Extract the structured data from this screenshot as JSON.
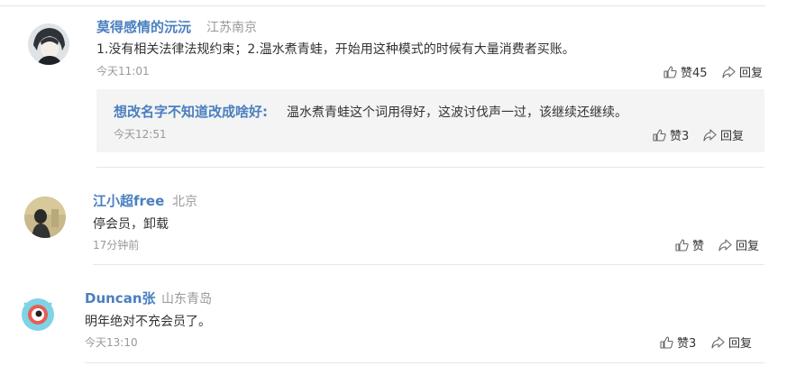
{
  "comments": [
    {
      "user": "莫得感情的沅沅",
      "location": "江苏南京",
      "text": "1.没有相关法律法规约束；2.温水煮青蛙，开始用这种模式的时候有大量消费者买账。",
      "time": "今天11:01",
      "like_label": "赞45",
      "reply_label": "回复",
      "nested_reply": {
        "user": "想改名字不知道改成啥好:",
        "text": "温水煮青蛙这个词用得好，这波讨伐声一过，该继续还继续。",
        "time": "今天12:51",
        "like_label": "赞3",
        "reply_label": "回复"
      }
    },
    {
      "user": "江小超free",
      "location": "北京",
      "text": "停会员，卸载",
      "time": "17分钟前",
      "like_label": "赞",
      "reply_label": "回复"
    },
    {
      "user": "Duncan张",
      "location": "山东青岛",
      "text": "明年绝对不充会员了。",
      "time": "今天13:10",
      "like_label": "赞3",
      "reply_label": "回复"
    }
  ],
  "icons": {
    "like": "thumbs-up-icon",
    "reply": "share-arrow-icon"
  },
  "colors": {
    "username": "#4a7fbf",
    "meta": "#999999",
    "reply_bg": "#f4f4f4",
    "divider": "#e6e6e6"
  }
}
